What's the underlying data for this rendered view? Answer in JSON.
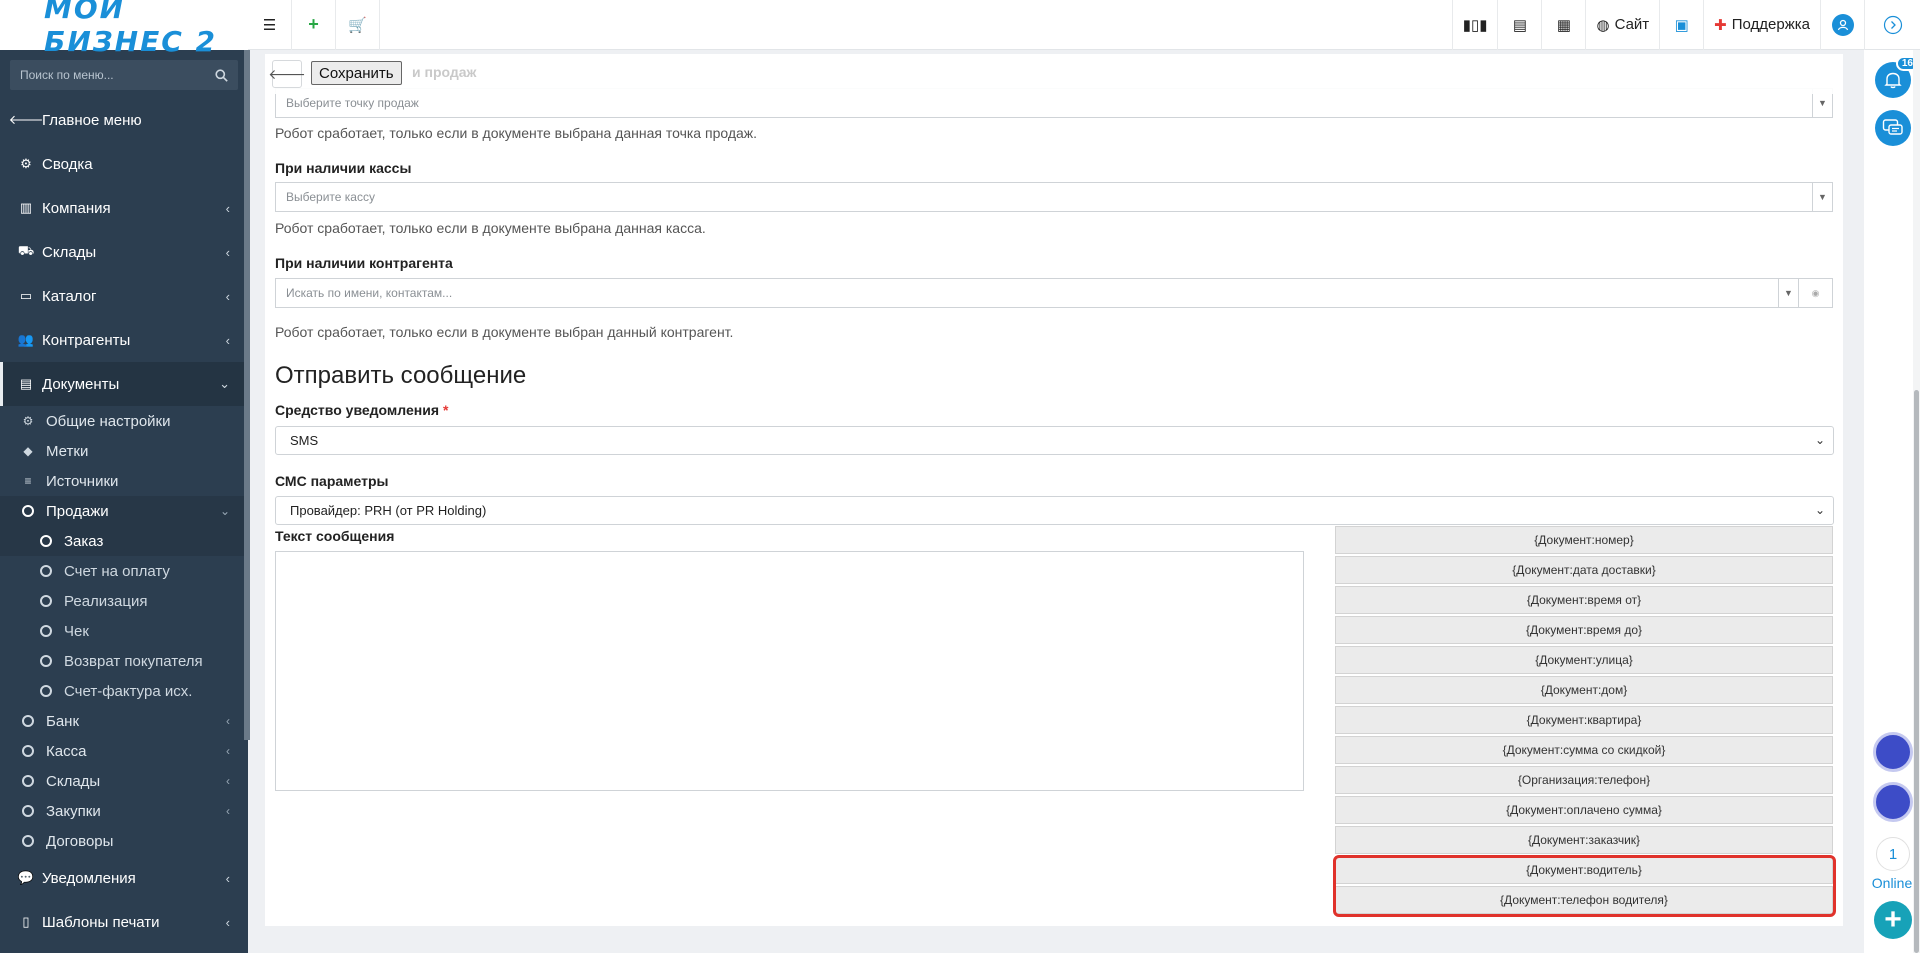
{
  "app": {
    "logo_text": "МОЙ БИЗНЕС 2"
  },
  "sidebar": {
    "search_placeholder": "Поиск по меню...",
    "items": [
      {
        "label": "Главное меню",
        "icon": "arrow-left-icon"
      },
      {
        "label": "Сводка",
        "icon": "gear-icon"
      },
      {
        "label": "Компания",
        "icon": "bar-chart-icon"
      },
      {
        "label": "Склады",
        "icon": "truck-icon"
      },
      {
        "label": "Каталог",
        "icon": "folder-open-icon"
      },
      {
        "label": "Контрагенты",
        "icon": "users-icon"
      },
      {
        "label": "Документы",
        "icon": "document-icon"
      }
    ],
    "doc_sub": [
      {
        "label": "Общие настройки",
        "icon": "cogs-icon"
      },
      {
        "label": "Метки",
        "icon": "tags-icon"
      },
      {
        "label": "Источники",
        "icon": "list-icon"
      },
      {
        "label": "Продажи",
        "icon": "circle-icon"
      }
    ],
    "sales_sub": [
      "Заказ",
      "Счет на оплату",
      "Реализация",
      "Чек",
      "Возврат покупателя",
      "Счет-фактура исх."
    ],
    "more_sub": [
      "Банк",
      "Касса",
      "Склады",
      "Закупки",
      "Договоры"
    ],
    "bottom": [
      {
        "label": "Уведомления",
        "icon": "comments-icon"
      },
      {
        "label": "Шаблоны печати",
        "icon": "file-icon"
      }
    ]
  },
  "topbar": {
    "site_label": "Сайт",
    "support_label": "Поддержка"
  },
  "rail": {
    "badge_count": "16",
    "online_count": "1",
    "online_label": "Online",
    "plus": "+"
  },
  "toolbar": {
    "save_label": "Сохранить",
    "ghost_label": "и продаж"
  },
  "form": {
    "point_placeholder": "Выберите точку продаж",
    "point_help": "Робот сработает, только если в документе выбрана данная точка продаж.",
    "kassa_label": "При наличии кассы",
    "kassa_placeholder": "Выберите кассу",
    "kassa_help": "Робот сработает, только если в документе выбрана данная касса.",
    "contractor_label": "При наличии контрагента",
    "contractor_placeholder": "Искать по имени, контактам...",
    "contractor_help": "Робот сработает, только если в документе выбран данный контрагент.",
    "section_title": "Отправить сообщение",
    "notify_label": "Средство уведомления",
    "notify_value": "SMS",
    "sms_label": "СМС параметры",
    "sms_value": "Провайдер: PRH (от PR Holding)",
    "message_label": "Текст сообщения"
  },
  "variables": [
    "{Документ:номер}",
    "{Документ:дата доставки}",
    "{Документ:время от}",
    "{Документ:время до}",
    "{Документ:улица}",
    "{Документ:дом}",
    "{Документ:квартира}",
    "{Документ:сумма со скидкой}",
    "{Организация:телефон}",
    "{Документ:оплачено сумма}",
    "{Документ:заказчик}",
    "{Документ:водитель}",
    "{Документ:телефон водителя}"
  ],
  "colors": {
    "sidebar_bg": "#2c3e50",
    "accent": "#1a8fd8",
    "highlight": "#e0322b",
    "support": "#e53935"
  }
}
